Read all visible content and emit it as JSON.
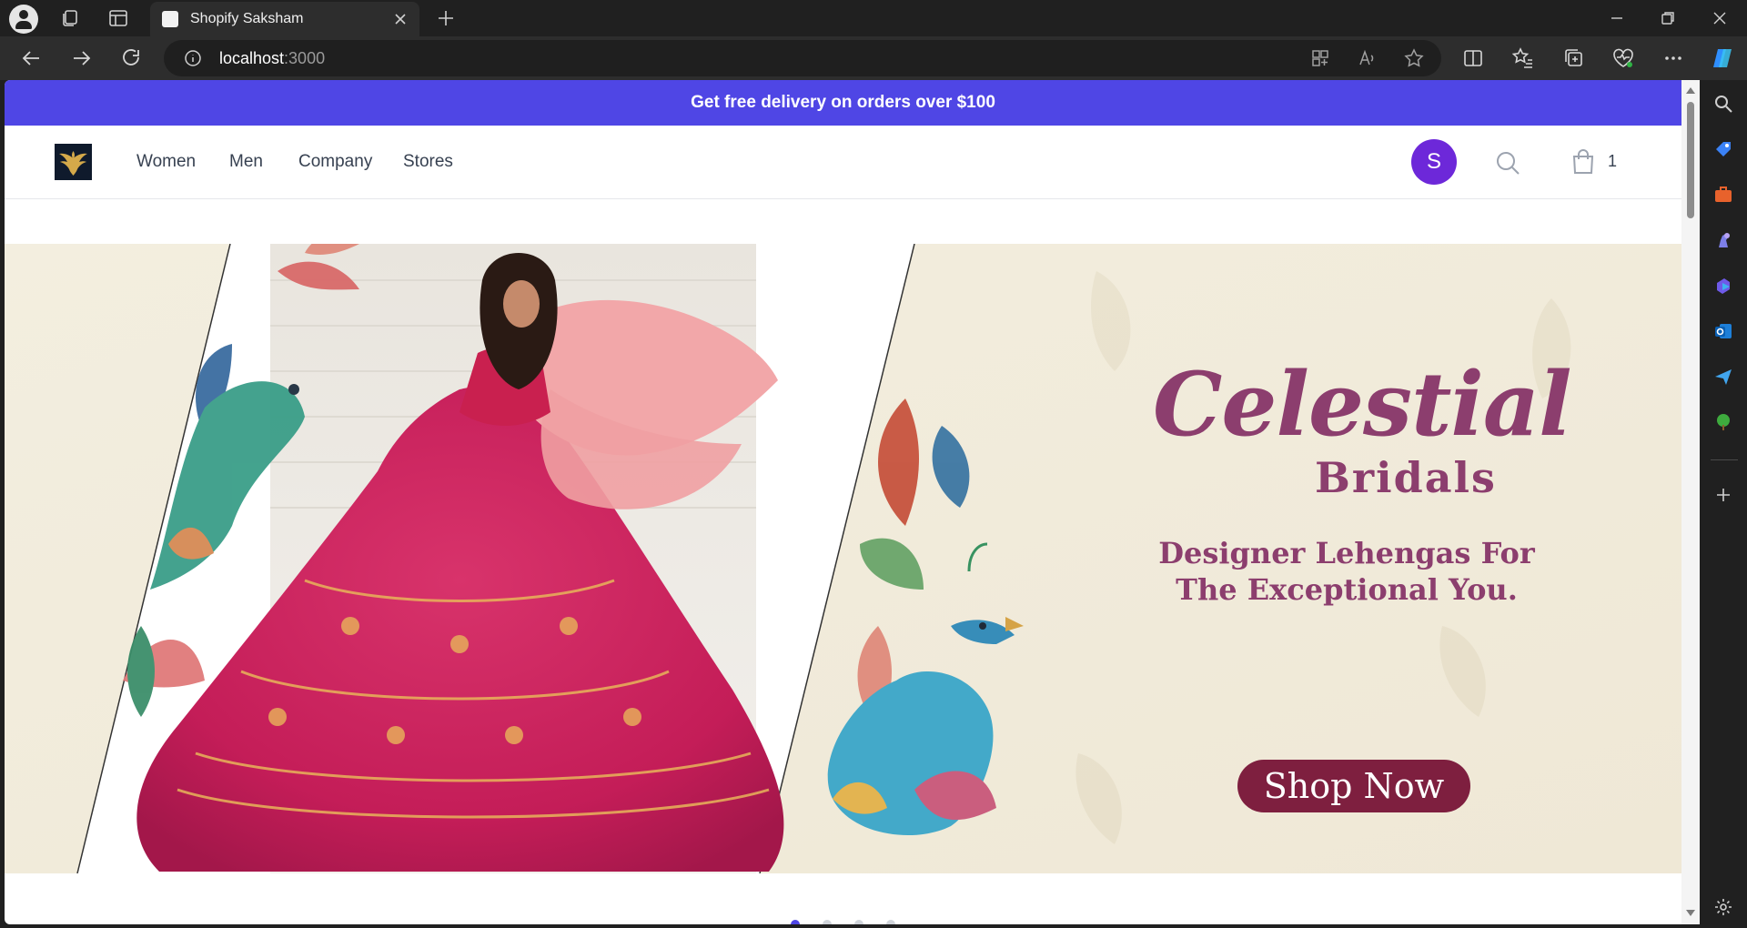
{
  "browser": {
    "tab_title": "Shopify Saksham",
    "url_host": "localhost",
    "url_port": ":3000"
  },
  "page": {
    "banner_text": "Get free delivery on orders over $100",
    "nav": [
      "Women",
      "Men",
      "Company",
      "Stores"
    ],
    "avatar_letter": "S",
    "cart_count": "1"
  },
  "hero": {
    "brand_title": "Celestial",
    "brand_subtitle": "Bridals",
    "tagline": "Designer Lehengas For The Exceptional You.",
    "cta_label": "Shop Now",
    "slide_dots": 4,
    "active_slide": 1
  },
  "colors": {
    "banner": "#4f46e5",
    "accent_text": "#8c3e6e",
    "cta": "#7e1f3f",
    "avatar": "#6d28d9"
  }
}
